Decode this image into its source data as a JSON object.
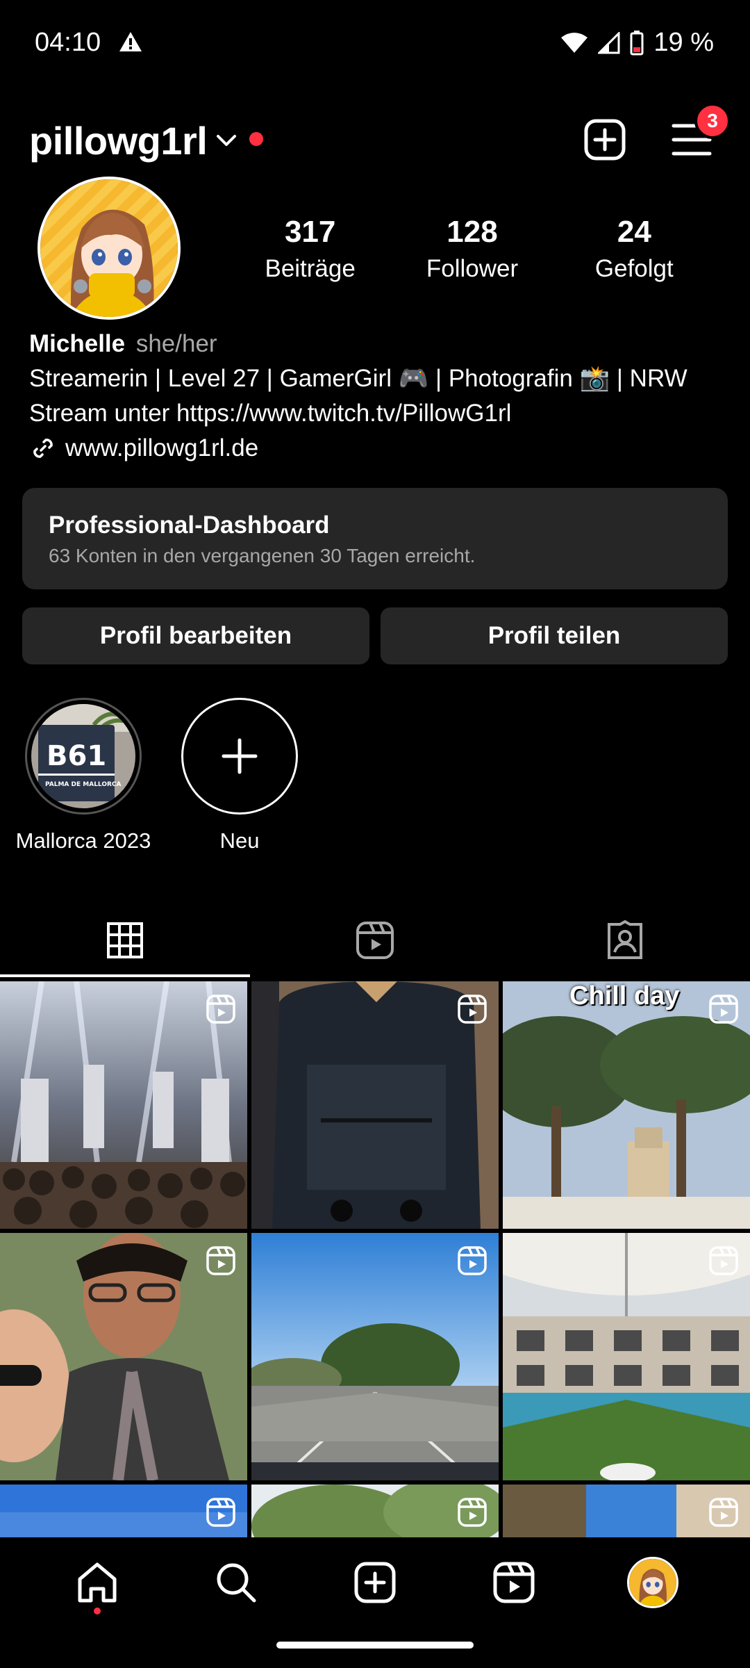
{
  "status_bar": {
    "time": "04:10",
    "battery": "19 %",
    "icons": [
      "warning-icon",
      "wifi-icon",
      "signal-icon",
      "battery-icon"
    ]
  },
  "header": {
    "username": "pillowg1rl",
    "menu_badge": "3"
  },
  "stats": [
    {
      "value": "317",
      "label": "Beiträge"
    },
    {
      "value": "128",
      "label": "Follower"
    },
    {
      "value": "24",
      "label": "Gefolgt"
    }
  ],
  "bio": {
    "name": "Michelle",
    "pronouns": "she/her",
    "line1": "Streamerin | Level 27 | GamerGirl 🎮 | Photografin 📸 | NRW",
    "line2": "Stream unter https://www.twitch.tv/PillowG1rl",
    "link": "www.pillowg1rl.de"
  },
  "dashboard": {
    "title": "Professional-Dashboard",
    "subtitle": "63 Konten in den vergangenen 30 Tagen erreicht."
  },
  "buttons": {
    "edit": "Profil bearbeiten",
    "share": "Profil teilen"
  },
  "highlights": [
    {
      "label": "Mallorca 2023",
      "sign_text": "B61",
      "sign_sub": "PALMA DE MALLORCA"
    },
    {
      "label": "Neu"
    }
  ],
  "tabs": [
    "grid-icon",
    "reels-icon",
    "tagged-icon"
  ],
  "grid_tiles": [
    {
      "overlay": ""
    },
    {
      "overlay": ""
    },
    {
      "overlay": "Chill day"
    },
    {
      "overlay": ""
    },
    {
      "overlay": ""
    },
    {
      "overlay": ""
    },
    {
      "overlay": ""
    },
    {
      "overlay": ""
    },
    {
      "overlay": ""
    }
  ],
  "bottom_nav": [
    "home-icon",
    "search-icon",
    "create-icon",
    "reels-icon",
    "profile-avatar"
  ],
  "colors": {
    "background": "#000000",
    "surface": "#262626",
    "badge": "#ff3040",
    "muted_text": "#a8a8a8"
  }
}
